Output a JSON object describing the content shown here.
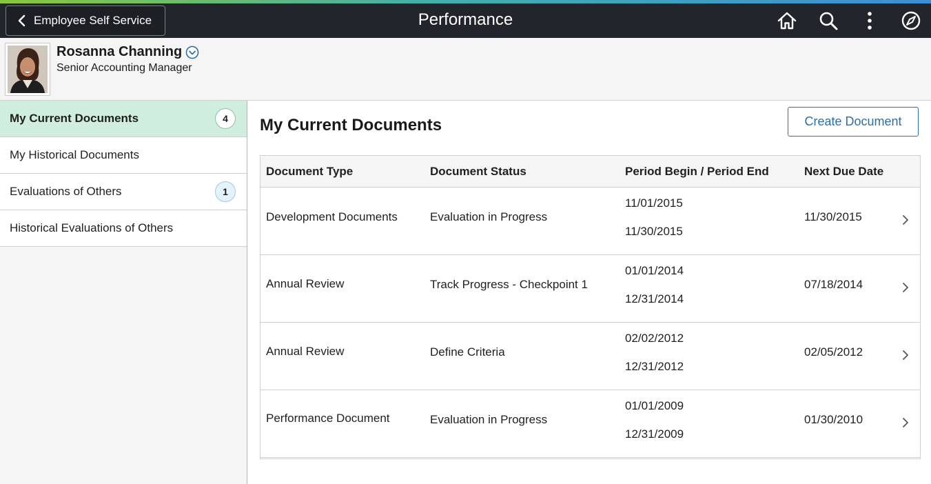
{
  "banner": {
    "back_label": "Employee Self Service",
    "title": "Performance",
    "icons": [
      "home-icon",
      "search-icon",
      "actions-menu-icon",
      "navbar-compass-icon"
    ],
    "stripe_colors": [
      "#8cc63f",
      "#46b0a8",
      "#3b8fd6"
    ],
    "background": "#22252b"
  },
  "employee": {
    "name": "Rosanna Channing",
    "title": "Senior Accounting Manager"
  },
  "nav": {
    "items": [
      {
        "label": "My Current Documents",
        "badge": "4",
        "active": true
      },
      {
        "label": "My Historical Documents",
        "badge": "",
        "active": false
      },
      {
        "label": "Evaluations of Others",
        "badge": "1",
        "active": false
      },
      {
        "label": "Historical Evaluations of Others",
        "badge": "",
        "active": false
      }
    ],
    "active_color": "#cfeedd"
  },
  "main": {
    "title": "My Current Documents",
    "create_label": "Create Document",
    "columns": [
      "Document Type",
      "Document Status",
      "Period Begin / Period End",
      "Next Due Date"
    ],
    "rows": [
      {
        "type": "Development Documents",
        "status": "Evaluation in Progress",
        "begin": "11/01/2015",
        "end": "11/30/2015",
        "due": "11/30/2015"
      },
      {
        "type": "Annual Review",
        "status": "Track Progress - Checkpoint 1",
        "begin": "01/01/2014",
        "end": "12/31/2014",
        "due": "07/18/2014"
      },
      {
        "type": "Annual Review",
        "status": "Define Criteria",
        "begin": "02/02/2012",
        "end": "12/31/2012",
        "due": "02/05/2012"
      },
      {
        "type": "Performance Document",
        "status": "Evaluation in Progress",
        "begin": "01/01/2009",
        "end": "12/31/2009",
        "due": "01/30/2010"
      }
    ],
    "accent_color": "#2d6ea3"
  }
}
